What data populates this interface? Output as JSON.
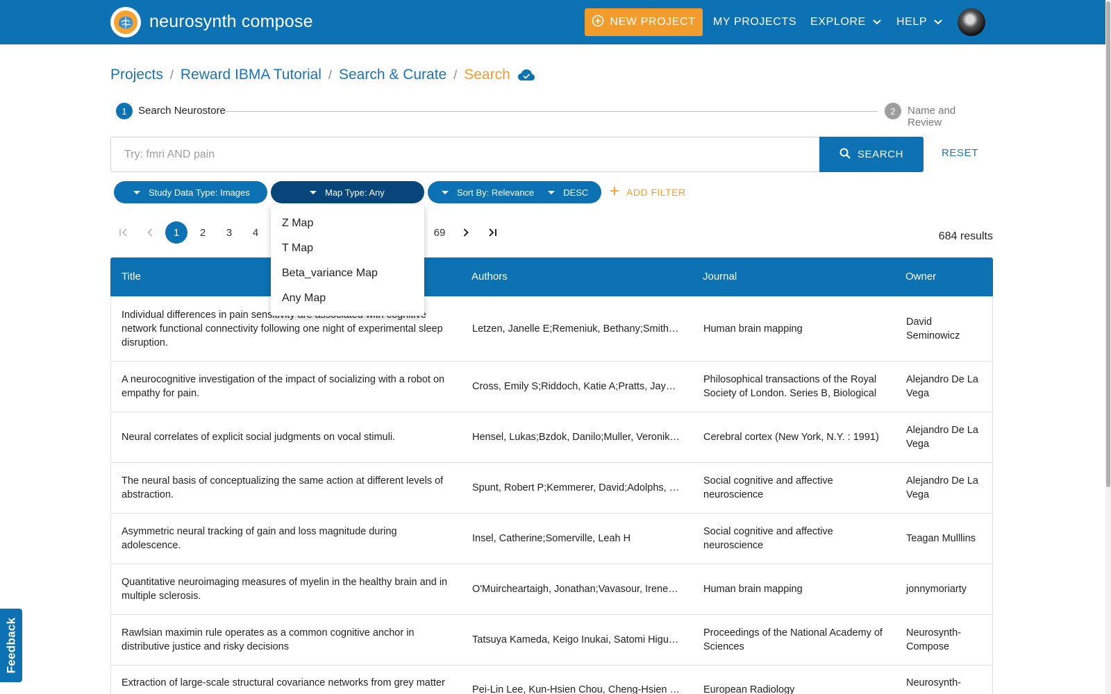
{
  "app": {
    "brand": "neurosynth compose"
  },
  "nav": {
    "new_project": "NEW PROJECT",
    "my_projects": "MY PROJECTS",
    "explore": "EXPLORE",
    "help": "HELP"
  },
  "breadcrumb": {
    "items": [
      "Projects",
      "Reward IBMA Tutorial",
      "Search & Curate",
      "Search"
    ]
  },
  "stepper": {
    "steps": [
      {
        "number": "1",
        "label": "Search Neurostore"
      },
      {
        "number": "2",
        "label": "Name and Review"
      }
    ]
  },
  "search": {
    "placeholder": "Try: fmri AND pain",
    "value": "",
    "search_label": "SEARCH",
    "reset_label": "RESET"
  },
  "filters": {
    "study_data_type": "Study Data Type: Images",
    "map_type": "Map Type: Any",
    "sort_by": "Sort By: Relevance",
    "order": "DESC",
    "add_filter": "ADD FILTER"
  },
  "map_type_dropdown": {
    "options": [
      "Z Map",
      "T Map",
      "Beta_variance Map",
      "Any Map"
    ]
  },
  "pagination": {
    "pages": [
      "1",
      "2",
      "3",
      "4"
    ],
    "last_page": "69",
    "current": "1",
    "results": "684 results"
  },
  "table": {
    "columns": [
      "Title",
      "Authors",
      "Journal",
      "Owner"
    ],
    "rows": [
      {
        "title": "Individual differences in pain sensitivity are associated with cognitive network functional connectivity following one night of experimental sleep disruption.",
        "authors": "Letzen, Janelle E;Remeniuk, Bethany;Smith, Michael T;Irwin, Michael R;Finan, Patrick H;Seminowicz, David A",
        "journal": "Human brain mapping",
        "owner": "David Seminowicz"
      },
      {
        "title": "A neurocognitive investigation of the impact of socializing with a robot on empathy for pain.",
        "authors": "Cross, Emily S;Riddoch, Katie A;Pratts, Jaydan;Titone, Simon;Chaudhury, Bishakha;Hortensius, Ruud",
        "journal": "Philosophical transactions of the Royal Society of London. Series B, Biological",
        "owner": "Alejandro De La Vega"
      },
      {
        "title": "Neural correlates of explicit social judgments on vocal stimuli.",
        "authors": "Hensel, Lukas;Bzdok, Danilo;Muller, Veronika I;Zilles, Karl;Eickhoff, Simon B",
        "journal": "Cerebral cortex (New York, N.Y. : 1991)",
        "owner": "Alejandro De La Vega"
      },
      {
        "title": "The neural basis of conceptualizing the same action at different levels of abstraction.",
        "authors": "Spunt, Robert P;Kemmerer, David;Adolphs, Ralph",
        "journal": "Social cognitive and affective neuroscience",
        "owner": "Alejandro De La Vega"
      },
      {
        "title": "Asymmetric neural tracking of gain and loss magnitude during adolescence.",
        "authors": "Insel, Catherine;Somerville, Leah H",
        "journal": "Social cognitive and affective neuroscience",
        "owner": "Teagan Mulllins"
      },
      {
        "title": "Quantitative neuroimaging measures of myelin in the healthy brain and in multiple sclerosis.",
        "authors": "O'Muircheartaigh, Jonathan;Vavasour, Irene;Ljungberg, Emil",
        "journal": "Human brain mapping",
        "owner": "jonnymoriarty"
      },
      {
        "title": "Rawlsian maximin rule operates as a common cognitive anchor in distributive justice and risky decisions",
        "authors": "Tatsuya Kameda, Keigo Inukai, Satomi Higuchi, Akitoshi Ogawa",
        "journal": "Proceedings of the National Academy of Sciences",
        "owner": "Neurosynth-Compose"
      },
      {
        "title": "Extraction of large-scale structural covariance networks from grey matter",
        "authors": "Pei-Lin Lee, Kun-Hsien Chou, Cheng-Hsien Lu",
        "journal": "European Radiology",
        "owner": "Neurosynth-"
      }
    ]
  },
  "feedback": {
    "label": "Feedback"
  },
  "colors": {
    "primary": "#0c72b3",
    "accent": "#f39c2e",
    "chip_active": "#08457a"
  }
}
